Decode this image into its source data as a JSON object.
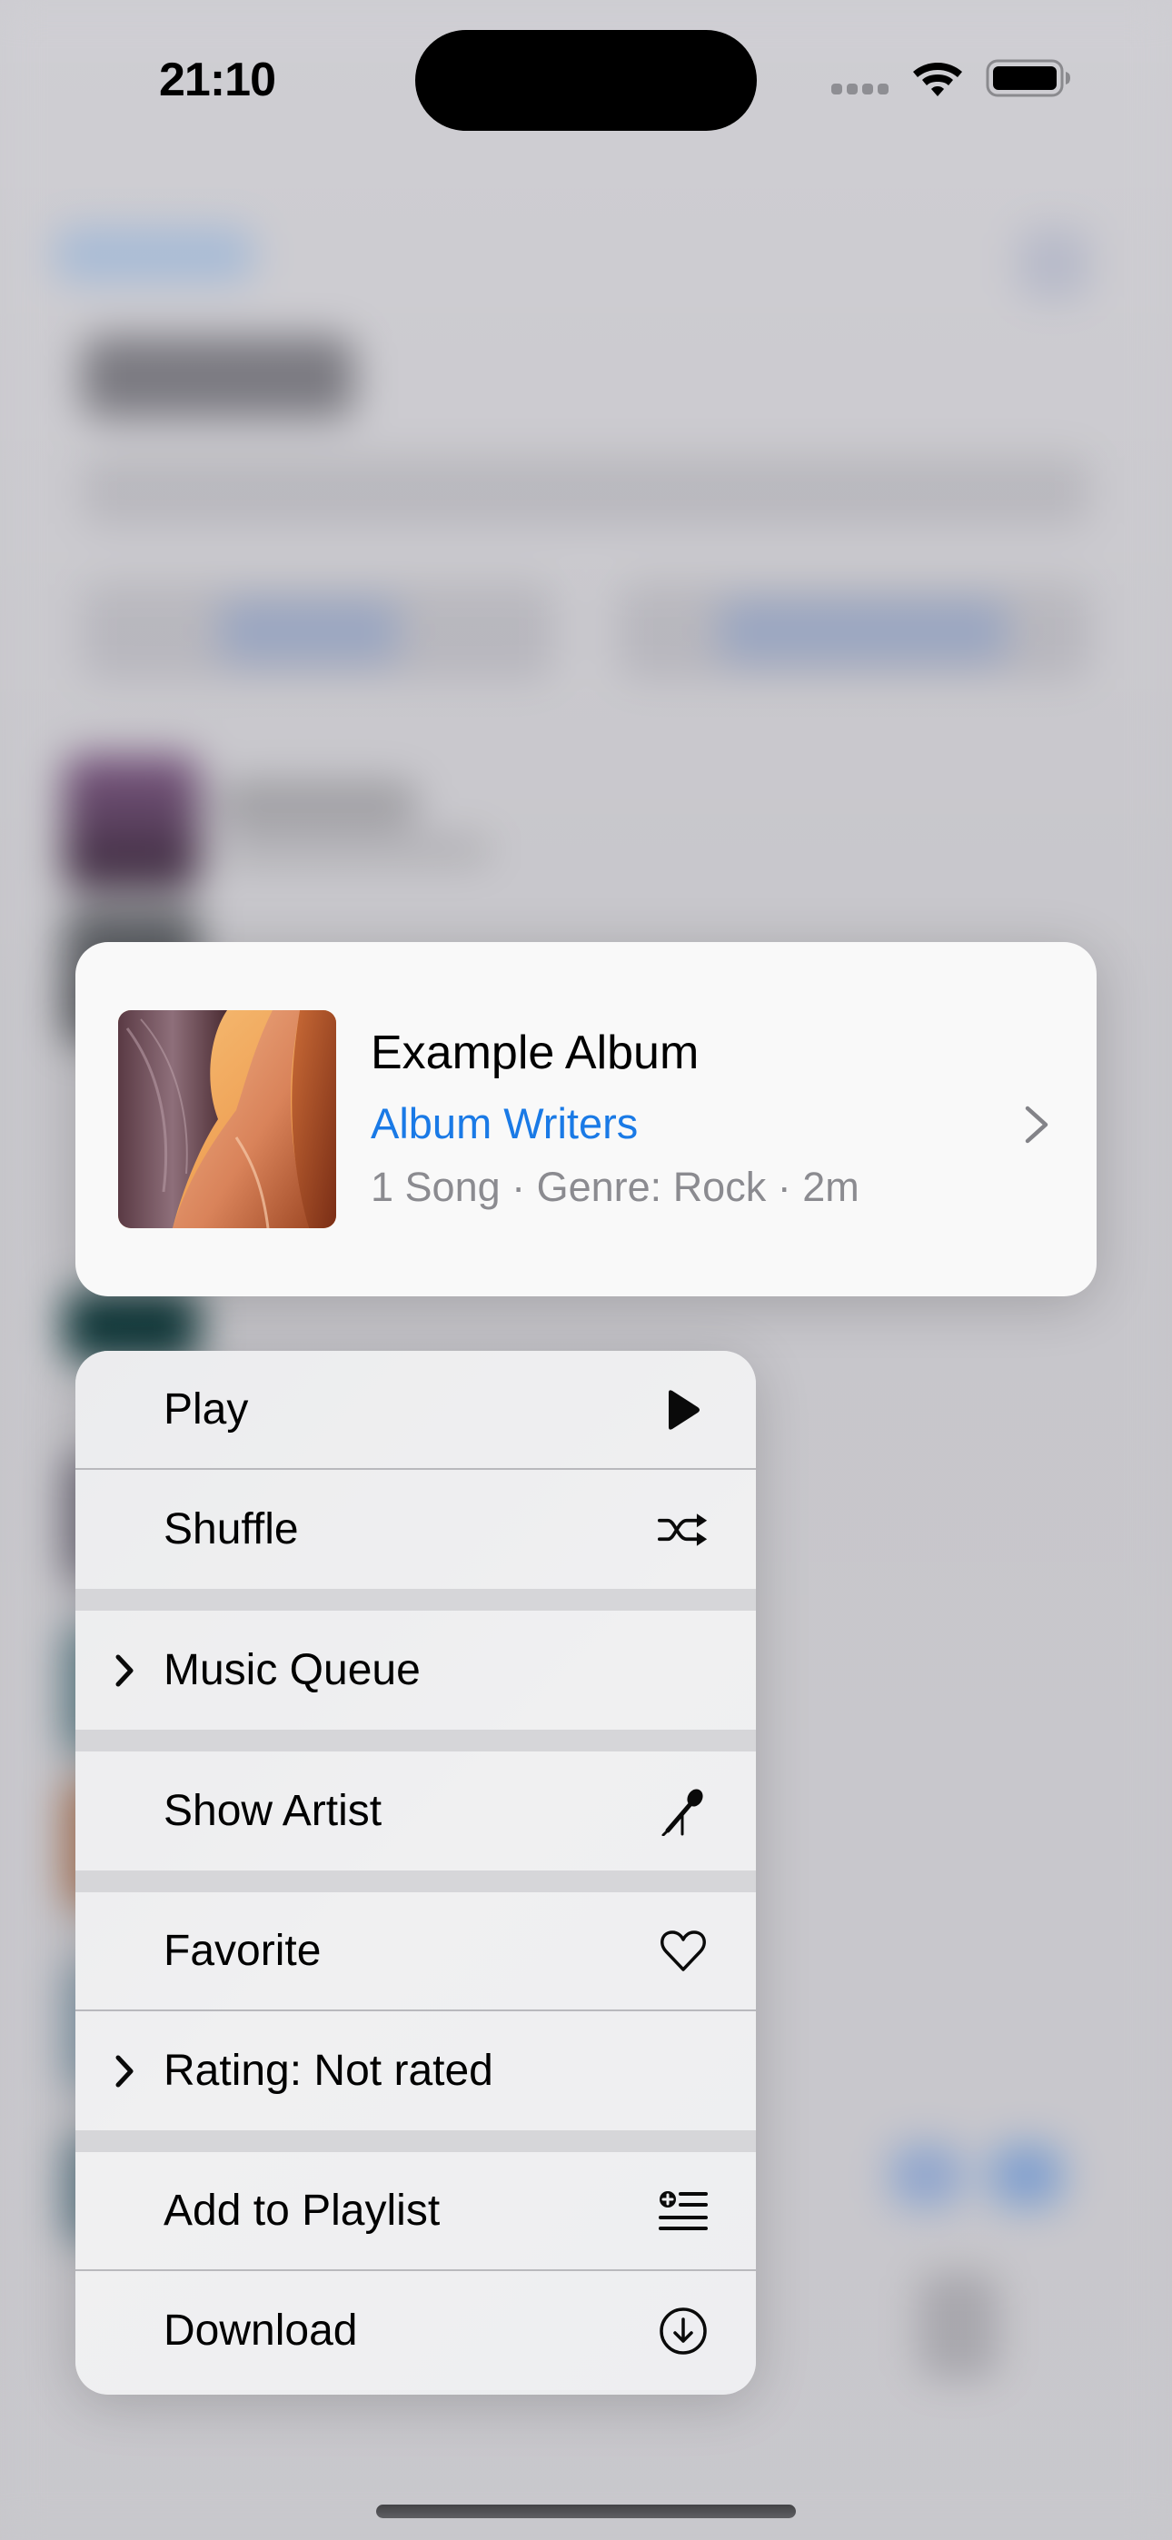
{
  "status_bar": {
    "time": "21:10",
    "signal_icon": "cellular-signal-icon",
    "wifi_icon": "wifi-icon",
    "battery_icon": "battery-full-icon"
  },
  "preview": {
    "title": "Example Album",
    "artist": "Album Writers",
    "meta": "1 Song · Genre: Rock · 2m",
    "artwork": "antelope-canyon-artwork",
    "chevron_icon": "chevron-right-icon",
    "artist_color": "#1a7ae6"
  },
  "menu": {
    "groups": [
      [
        {
          "label": "Play",
          "icon": "play-icon",
          "submenu": false
        },
        {
          "label": "Shuffle",
          "icon": "shuffle-icon",
          "submenu": false
        }
      ],
      [
        {
          "label": "Music Queue",
          "icon": null,
          "submenu": true
        }
      ],
      [
        {
          "label": "Show Artist",
          "icon": "microphone-icon",
          "submenu": false
        }
      ],
      [
        {
          "label": "Favorite",
          "icon": "heart-icon",
          "submenu": false
        },
        {
          "label": "Rating: Not rated",
          "icon": null,
          "submenu": true
        }
      ],
      [
        {
          "label": "Add to Playlist",
          "icon": "add-to-playlist-icon",
          "submenu": false
        },
        {
          "label": "Download",
          "icon": "download-icon",
          "submenu": false
        }
      ]
    ]
  },
  "colors": {
    "accent": "#1a7ae6",
    "menu_separator": "#d6d6d9",
    "secondary_text": "#8b8b90"
  }
}
